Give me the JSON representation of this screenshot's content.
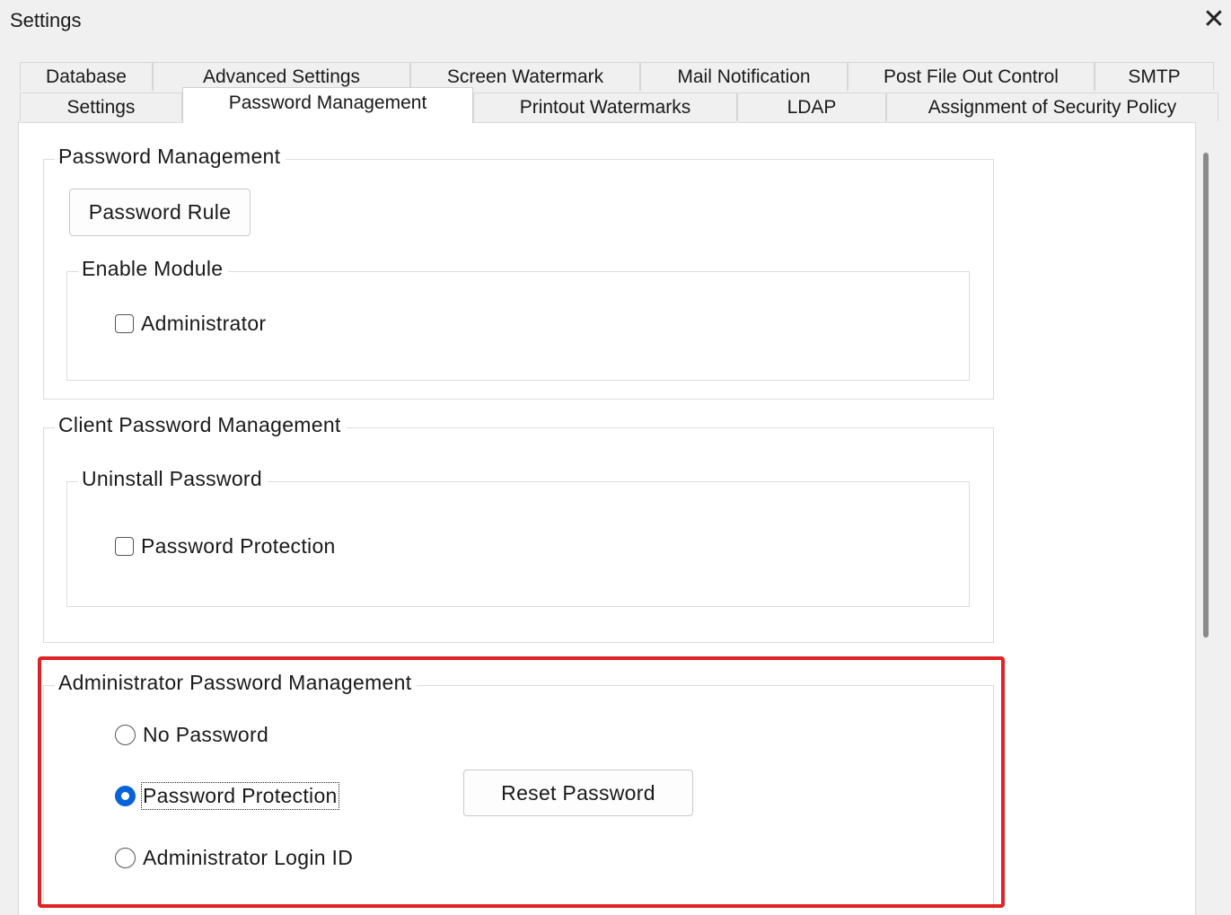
{
  "window": {
    "title": "Settings",
    "close_icon": "close-icon"
  },
  "tabs": {
    "row1": [
      "Database",
      "Advanced Settings",
      "Screen Watermark",
      "Mail Notification",
      "Post File Out Control",
      "SMTP"
    ],
    "row2": [
      "Settings",
      "Password Management",
      "Printout Watermarks",
      "LDAP",
      "Assignment of Security Policy"
    ],
    "active": "Password Management"
  },
  "password_management": {
    "legend": "Password Management",
    "password_rule_button": "Password Rule",
    "enable_module": {
      "legend": "Enable Module",
      "administrator_label": "Administrator",
      "administrator_checked": false
    }
  },
  "client_password_management": {
    "legend": "Client Password Management",
    "uninstall_password": {
      "legend": "Uninstall Password",
      "password_protection_label": "Password Protection",
      "password_protection_checked": false
    }
  },
  "admin_password_management": {
    "legend": "Administrator Password Management",
    "options": [
      "No Password",
      "Password Protection",
      "Administrator Login ID"
    ],
    "selected": "Password Protection",
    "reset_password_button": "Reset Password"
  },
  "colors": {
    "highlight": "#e02424",
    "radio_selected": "#0a63d6"
  }
}
